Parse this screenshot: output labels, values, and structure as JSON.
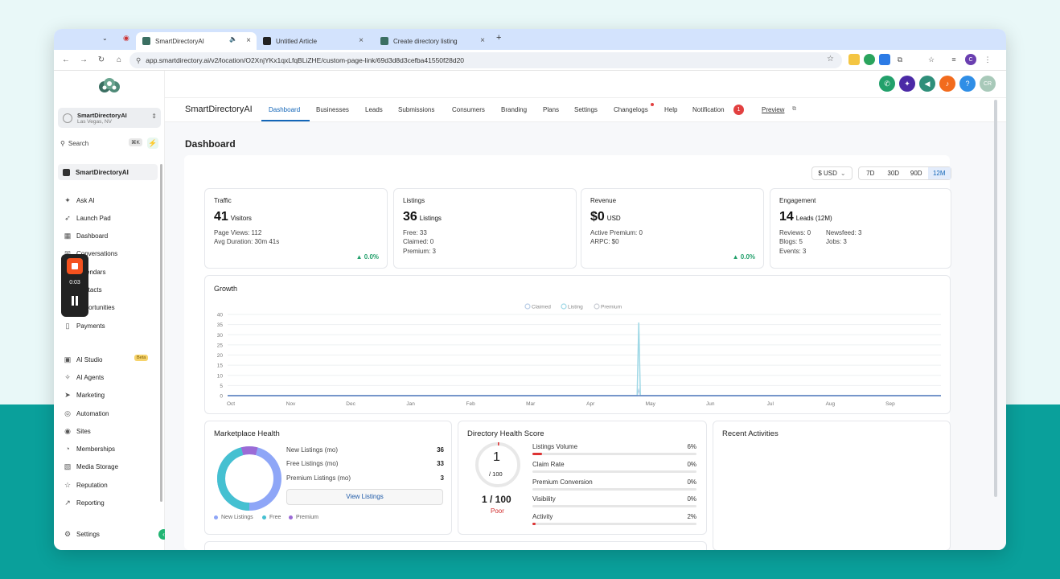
{
  "browser": {
    "tabs": [
      {
        "title": "SmartDirectoryAI",
        "favicon_color": "#3b6f62"
      },
      {
        "title": "Untitled Article",
        "favicon_color": "#222222"
      },
      {
        "title": "Create directory listing",
        "favicon_color": "#3b6f62"
      }
    ],
    "url": "app.smartdirectory.ai/v2/location/O2XnjYKx1qxLfqBLiZHE/custom-page-link/69d3d8d3cefba41550f28d20"
  },
  "recorder": {
    "time": "0:03"
  },
  "sidebar": {
    "account_name": "SmartDirectoryAI",
    "account_location": "Las Vegas, NV",
    "search_label": "Search",
    "search_shortcut": "⌘K",
    "workspace": "SmartDirectoryAI",
    "items": [
      {
        "label": "Ask AI",
        "icon": "✦"
      },
      {
        "label": "Launch Pad",
        "icon": "➶"
      },
      {
        "label": "Dashboard",
        "icon": "▦"
      },
      {
        "label": "Conversations",
        "icon": "✉"
      },
      {
        "label": "Calendars",
        "icon": "▤"
      },
      {
        "label": "Contacts",
        "icon": "☐"
      },
      {
        "label": "Opportunities",
        "icon": "⁘"
      },
      {
        "label": "Payments",
        "icon": "▯"
      },
      {
        "label": "AI Studio",
        "icon": "▣"
      },
      {
        "label": "AI Agents",
        "icon": "✧"
      },
      {
        "label": "Marketing",
        "icon": "➤"
      },
      {
        "label": "Automation",
        "icon": "◎"
      },
      {
        "label": "Sites",
        "icon": "◉"
      },
      {
        "label": "Memberships",
        "icon": "◔"
      },
      {
        "label": "Media Storage",
        "icon": "▧"
      },
      {
        "label": "Reputation",
        "icon": "☆"
      },
      {
        "label": "Reporting",
        "icon": "↗"
      },
      {
        "label": "Settings",
        "icon": "⚙"
      }
    ],
    "beta_label": "Beta"
  },
  "header": {
    "avatar_initials": "CR"
  },
  "topnav": {
    "brand": "SmartDirectoryAI",
    "items": [
      "Dashboard",
      "Businesses",
      "Leads",
      "Submissions",
      "Consumers",
      "Branding",
      "Plans",
      "Settings",
      "Changelogs",
      "Help",
      "Notification",
      "Preview"
    ],
    "notification_count": "1"
  },
  "page": {
    "title": "Dashboard"
  },
  "filters": {
    "currency": "$ USD",
    "ranges": [
      "7D",
      "30D",
      "90D",
      "12M"
    ],
    "selected_range": "12M"
  },
  "stats": {
    "traffic": {
      "title": "Traffic",
      "value": "41",
      "unit": "Visitors",
      "line1": "Page Views: 112",
      "line2": "Avg Duration: 30m 41s",
      "delta": "▲ 0.0%"
    },
    "listings": {
      "title": "Listings",
      "value": "36",
      "unit": "Listings",
      "line1": "Free: 33",
      "line2": "Claimed: 0",
      "line3": "Premium: 3"
    },
    "revenue": {
      "title": "Revenue",
      "value": "$0",
      "unit": "USD",
      "line1": "Active Premium: 0",
      "line2": "ARPC: $0",
      "delta": "▲ 0.0%"
    },
    "engagement": {
      "title": "Engagement",
      "value": "14",
      "unit": "Leads (12M)",
      "line1a": "Reviews: 0",
      "line1b": "Newsfeed: 3",
      "line2a": "Blogs: 5",
      "line2b": "Jobs: 3",
      "line3": "Events: 3"
    }
  },
  "growth": {
    "title": "Growth"
  },
  "chart_data": {
    "type": "line",
    "title": "Growth",
    "x": [
      "Oct",
      "Nov",
      "Dec",
      "Jan",
      "Feb",
      "Mar",
      "Apr",
      "May",
      "Jun",
      "Jul",
      "Aug",
      "Sep"
    ],
    "ylim": [
      0,
      40
    ],
    "yticks": [
      0,
      5,
      10,
      15,
      20,
      25,
      30,
      35,
      40
    ],
    "series": [
      {
        "name": "Claimed",
        "color": "#b9cde6",
        "spike_value": 3
      },
      {
        "name": "Listing",
        "color": "#9fd8e6",
        "spike_value": 36
      },
      {
        "name": "Premium",
        "color": "#c9cdd4",
        "spike_value": 0
      }
    ],
    "spike_date": "Apr",
    "grid": true,
    "legend": "top-center"
  },
  "marketplace_health": {
    "title": "Marketplace Health",
    "rows": [
      {
        "label": "New Listings (mo)",
        "value": "36"
      },
      {
        "label": "Free Listings (mo)",
        "value": "33"
      },
      {
        "label": "Premium Listings (mo)",
        "value": "3"
      }
    ],
    "button": "View Listings",
    "legend": [
      {
        "label": "New Listings",
        "color": "#8ea6f7"
      },
      {
        "label": "Free",
        "color": "#45c0d1"
      },
      {
        "label": "Premium",
        "color": "#9b6bd6"
      }
    ],
    "donut_shares": {
      "new_listings": 36,
      "free": 33,
      "premium": 3
    }
  },
  "directory_health": {
    "title": "Directory Health Score",
    "score": "1",
    "score_den": "/ 100",
    "score_full": "1 / 100",
    "rating": "Poor",
    "metrics": [
      {
        "label": "Listings Volume",
        "pct": "6%",
        "value": 6
      },
      {
        "label": "Claim Rate",
        "pct": "0%",
        "value": 0
      },
      {
        "label": "Premium Conversion",
        "pct": "0%",
        "value": 0
      },
      {
        "label": "Visibility",
        "pct": "0%",
        "value": 0
      },
      {
        "label": "Activity",
        "pct": "2%",
        "value": 2
      }
    ]
  },
  "recent_activities": {
    "title": "Recent Activities"
  }
}
